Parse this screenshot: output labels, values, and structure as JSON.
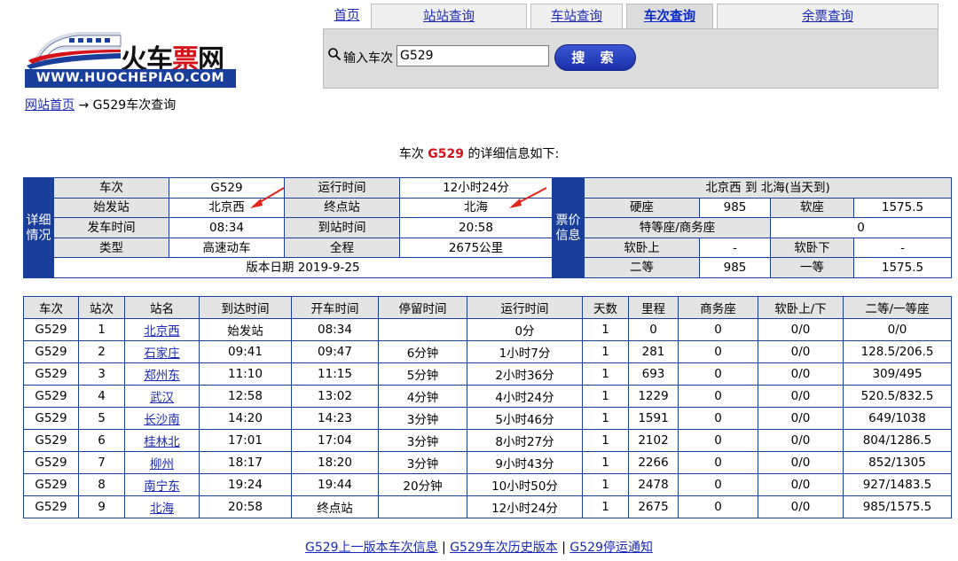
{
  "logo": {
    "text_black": "火车",
    "text_red": "票",
    "text_black2": "网",
    "url": "WWW.HUOCHEPIAO.COM"
  },
  "nav": {
    "tabs": [
      {
        "label": "首页"
      },
      {
        "label": "站站查询"
      },
      {
        "label": "车站查询"
      },
      {
        "label": "车次查询"
      },
      {
        "label": "余票查询"
      }
    ],
    "active": "车次查询"
  },
  "search": {
    "label": "输入车次",
    "value": "G529",
    "button": "搜 索"
  },
  "breadcrumb": {
    "home": "网站首页",
    "arrow": "→",
    "current": "G529车次查询"
  },
  "heading": {
    "prefix": "车次",
    "train": "G529",
    "suffix": "的详细信息如下:"
  },
  "info": {
    "side_left": "详细情况",
    "side_right": "票价信息",
    "rows": [
      [
        "车次",
        "G529",
        "运行时间",
        "12小时24分"
      ],
      [
        "始发站",
        "北京西",
        "终点站",
        "北海"
      ],
      [
        "发车时间",
        "08:34",
        "到站时间",
        "20:58"
      ],
      [
        "类型",
        "高速动车",
        "全程",
        "2675公里"
      ]
    ],
    "version": "版本日期 2019-9-25",
    "route": "北京西 到 北海(当天到)",
    "price": {
      "hard_seat_label": "硬座",
      "hard_seat": "985",
      "soft_seat_label": "软座",
      "soft_seat": "1575.5",
      "special_label": "特等座/商务座",
      "special": "0",
      "soft_sleeper_up_label": "软卧上",
      "soft_sleeper_up": "-",
      "soft_sleeper_down_label": "软卧下",
      "soft_sleeper_down": "-",
      "second_label": "二等",
      "second": "985",
      "first_label": "一等",
      "first": "1575.5"
    }
  },
  "schedule": {
    "headers": [
      "车次",
      "站次",
      "站名",
      "到达时间",
      "开车时间",
      "停留时间",
      "运行时间",
      "天数",
      "里程",
      "商务座",
      "软卧上/下",
      "二等/一等座"
    ],
    "rows": [
      [
        "G529",
        "1",
        "北京西",
        "始发站",
        "08:34",
        "",
        "0分",
        "1",
        "0",
        "0",
        "0/0",
        "0/0"
      ],
      [
        "G529",
        "2",
        "石家庄",
        "09:41",
        "09:47",
        "6分钟",
        "1小时7分",
        "1",
        "281",
        "0",
        "0/0",
        "128.5/206.5"
      ],
      [
        "G529",
        "3",
        "郑州东",
        "11:10",
        "11:15",
        "5分钟",
        "2小时36分",
        "1",
        "693",
        "0",
        "0/0",
        "309/495"
      ],
      [
        "G529",
        "4",
        "武汉",
        "12:58",
        "13:02",
        "4分钟",
        "4小时24分",
        "1",
        "1229",
        "0",
        "0/0",
        "520.5/832.5"
      ],
      [
        "G529",
        "5",
        "长沙南",
        "14:20",
        "14:23",
        "3分钟",
        "5小时46分",
        "1",
        "1591",
        "0",
        "0/0",
        "649/1038"
      ],
      [
        "G529",
        "6",
        "桂林北",
        "17:01",
        "17:04",
        "3分钟",
        "8小时27分",
        "1",
        "2102",
        "0",
        "0/0",
        "804/1286.5"
      ],
      [
        "G529",
        "7",
        "柳州",
        "18:17",
        "18:20",
        "3分钟",
        "9小时43分",
        "1",
        "2266",
        "0",
        "0/0",
        "852/1305"
      ],
      [
        "G529",
        "8",
        "南宁东",
        "19:24",
        "19:44",
        "20分钟",
        "10小时50分",
        "1",
        "2478",
        "0",
        "0/0",
        "927/1483.5"
      ],
      [
        "G529",
        "9",
        "北海",
        "20:58",
        "终点站",
        "",
        "12小时24分",
        "1",
        "2675",
        "0",
        "0/0",
        "985/1575.5"
      ]
    ]
  },
  "footer": {
    "links": [
      "G529上一版本车次信息",
      "G529车次历史版本",
      "G529停运通知"
    ],
    "separator": "|"
  },
  "colors": {
    "brand_blue": "#1a3f9b",
    "link": "#1a2ab5",
    "accent_red": "#d4121a",
    "header_gray": "#e4e4e4"
  }
}
